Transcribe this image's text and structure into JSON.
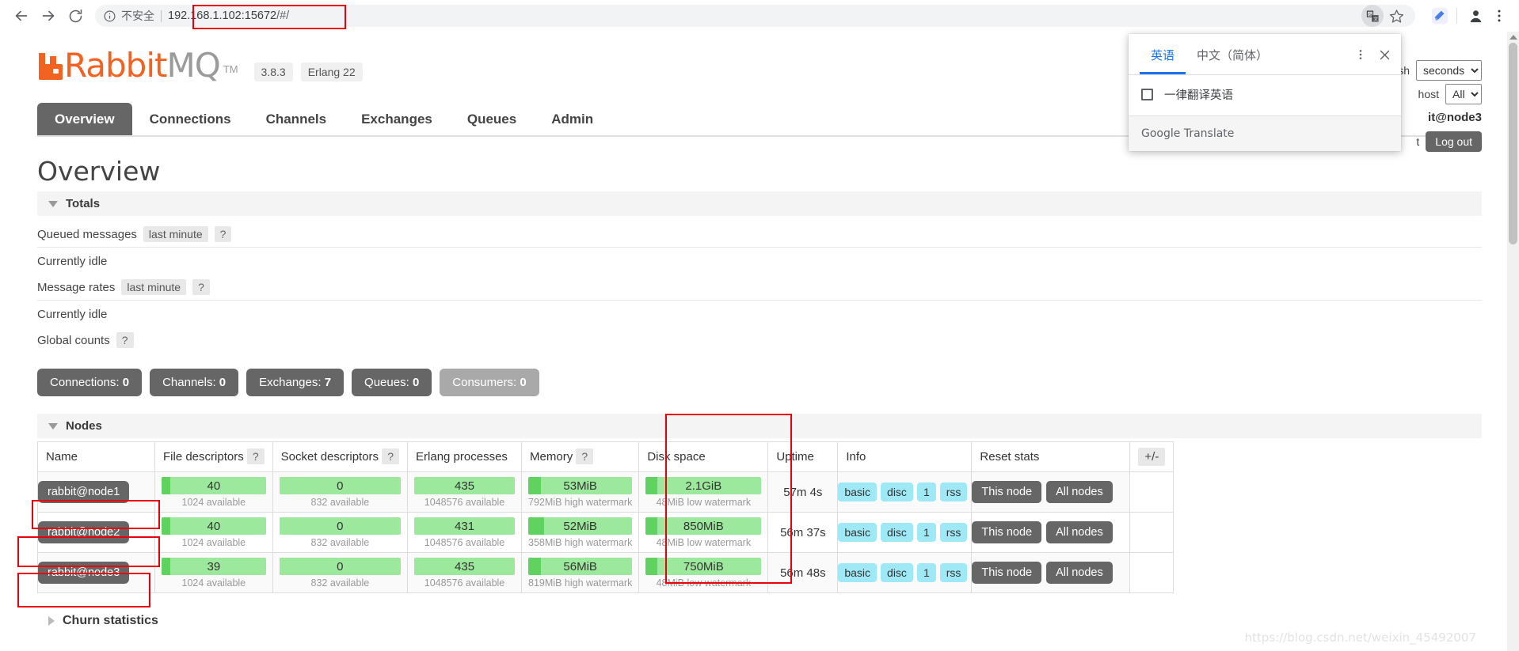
{
  "browser": {
    "back_icon": "back-arrow-icon",
    "forward_icon": "forward-arrow-icon",
    "reload_icon": "reload-icon",
    "security_label": "不安全",
    "url": "192.168.1.102:15672/#/",
    "url_host": "192.168.1.102:15672",
    "url_path": "/#/",
    "translate_icon": "translate-icon",
    "bookmark_icon": "star-icon",
    "extension_icon": "extension-icon",
    "profile_icon": "profile-avatar-icon",
    "menu_icon": "three-dot-menu-icon"
  },
  "translate_popup": {
    "tabs": [
      {
        "label": "英语",
        "active": true
      },
      {
        "label": "中文（简体）",
        "active": false
      }
    ],
    "kebab_icon": "more-options-icon",
    "close_icon": "close-icon",
    "checkbox_label": "一律翻译英语",
    "checkbox_checked": false,
    "footer": "Google Translate"
  },
  "rabbitmq": {
    "logo_rabbit": "Rabbit",
    "logo_mq": "MQ",
    "logo_tm": "TM",
    "version": "3.8.3",
    "erlang": "Erlang 22",
    "header_right": {
      "refresh_label": "Refresh",
      "refresh_interval": "seconds",
      "vhost_label": "host",
      "vhost_value": "All",
      "cluster_label": "it@node3",
      "user_label": "t",
      "logout": "Log out"
    },
    "nav_tabs": [
      {
        "label": "Overview",
        "active": true
      },
      {
        "label": "Connections",
        "active": false
      },
      {
        "label": "Channels",
        "active": false
      },
      {
        "label": "Exchanges",
        "active": false
      },
      {
        "label": "Queues",
        "active": false
      },
      {
        "label": "Admin",
        "active": false
      }
    ],
    "page_title": "Overview",
    "totals": {
      "section_label": "Totals",
      "queued_messages_label": "Queued messages",
      "queued_messages_period": "last minute",
      "queued_messages_help": "?",
      "queued_messages_status": "Currently idle",
      "message_rates_label": "Message rates",
      "message_rates_period": "last minute",
      "message_rates_help": "?",
      "message_rates_status": "Currently idle",
      "global_counts_label": "Global counts",
      "global_counts_help": "?"
    },
    "counters": [
      {
        "label": "Connections:",
        "value": "0",
        "muted": false
      },
      {
        "label": "Channels:",
        "value": "0",
        "muted": false
      },
      {
        "label": "Exchanges:",
        "value": "7",
        "muted": false
      },
      {
        "label": "Queues:",
        "value": "0",
        "muted": false
      },
      {
        "label": "Consumers:",
        "value": "0",
        "muted": true
      }
    ],
    "nodes_section_label": "Nodes",
    "nodes_columns": [
      "Name",
      "File descriptors",
      "Socket descriptors",
      "Erlang processes",
      "Memory",
      "Disk space",
      "Uptime",
      "Info",
      "Reset stats"
    ],
    "column_help": {
      "file_descriptors": "?",
      "socket_descriptors": "?",
      "memory": "?",
      "disk_space": ""
    },
    "plus_minus": "+/-",
    "nodes": [
      {
        "name": "rabbit@node1",
        "file_descriptors": {
          "value": "40",
          "sub": "1024 available",
          "pct": 6
        },
        "socket_descriptors": {
          "value": "0",
          "sub": "832 available",
          "pct": 0
        },
        "erlang_processes": {
          "value": "435",
          "sub": "1048576 available",
          "pct": 0
        },
        "memory": {
          "value": "53MiB",
          "sub": "792MiB high watermark",
          "pct": 11
        },
        "disk_space": {
          "value": "2.1GiB",
          "sub": "48MiB low watermark",
          "pct": 9
        },
        "uptime": "57m 4s",
        "info": [
          "basic",
          "disc",
          "1",
          "rss"
        ],
        "reset": [
          "This node",
          "All nodes"
        ]
      },
      {
        "name": "rabbit@node2",
        "file_descriptors": {
          "value": "40",
          "sub": "1024 available",
          "pct": 6
        },
        "socket_descriptors": {
          "value": "0",
          "sub": "832 available",
          "pct": 0
        },
        "erlang_processes": {
          "value": "431",
          "sub": "1048576 available",
          "pct": 0
        },
        "memory": {
          "value": "52MiB",
          "sub": "358MiB high watermark",
          "pct": 14
        },
        "disk_space": {
          "value": "850MiB",
          "sub": "48MiB low watermark",
          "pct": 9
        },
        "uptime": "56m 37s",
        "info": [
          "basic",
          "disc",
          "1",
          "rss"
        ],
        "reset": [
          "This node",
          "All nodes"
        ]
      },
      {
        "name": "rabbit@node3",
        "file_descriptors": {
          "value": "39",
          "sub": "1024 available",
          "pct": 6
        },
        "socket_descriptors": {
          "value": "0",
          "sub": "832 available",
          "pct": 0
        },
        "erlang_processes": {
          "value": "435",
          "sub": "1048576 available",
          "pct": 0
        },
        "memory": {
          "value": "56MiB",
          "sub": "819MiB high watermark",
          "pct": 11
        },
        "disk_space": {
          "value": "750MiB",
          "sub": "48MiB low watermark",
          "pct": 9
        },
        "uptime": "56m 48s",
        "info": [
          "basic",
          "disc",
          "1",
          "rss"
        ],
        "reset": [
          "This node",
          "All nodes"
        ]
      }
    ],
    "churn_label": "Churn statistics"
  },
  "watermark": "https://blog.csdn.net/weixin_45492007",
  "colors": {
    "brand_orange": "#f26322",
    "annotation_red": "#e8000d",
    "gauge_green": "#9ce89c",
    "gauge_fill": "#5fd25f",
    "info_badge": "#9fe9f7",
    "dark_button": "#666666",
    "translate_blue": "#1a73e8"
  }
}
